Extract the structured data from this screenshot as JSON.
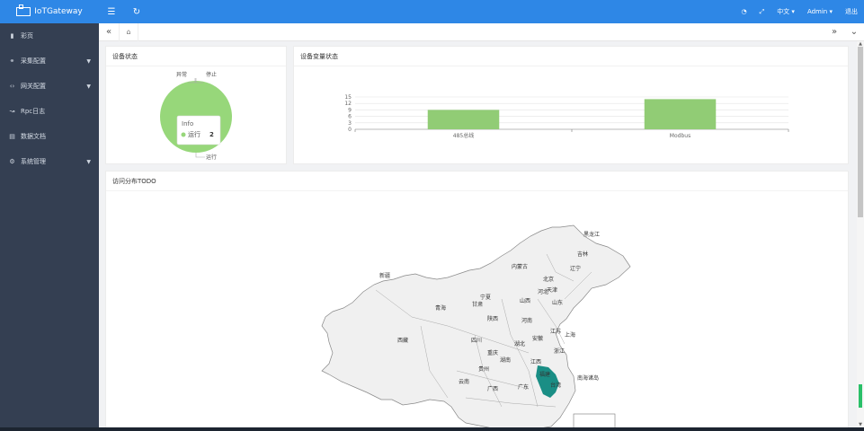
{
  "brand": {
    "name": "IoTGateway"
  },
  "sidebar": {
    "items": [
      {
        "label": "彩页",
        "icon": "dashboard-icon",
        "has_children": false
      },
      {
        "label": "采集配置",
        "icon": "link-icon",
        "has_children": true
      },
      {
        "label": "网关配置",
        "icon": "code-icon",
        "has_children": true
      },
      {
        "label": "Rpc日志",
        "icon": "route-icon",
        "has_children": false
      },
      {
        "label": "数据文档",
        "icon": "document-icon",
        "has_children": false
      },
      {
        "label": "系统管理",
        "icon": "gear-icon",
        "has_children": true
      }
    ]
  },
  "topbar": {
    "menu_icon": "menu-icon",
    "refresh_icon": "refresh-icon",
    "theme_icon": "palette-icon",
    "fullscreen_icon": "fullscreen-icon",
    "language": "中文",
    "user": "Admin",
    "logout": "退出"
  },
  "tabs": {
    "prev": "«",
    "next": "»",
    "more": "⌄"
  },
  "cards": {
    "device_status": {
      "title": "设备状态",
      "labels": {
        "abnormal": "异常",
        "stopped": "停止",
        "running": "运行"
      },
      "tooltip": {
        "title": "Info",
        "label": "运行",
        "value": "2"
      },
      "color": "#97d77a"
    },
    "variable_status": {
      "title": "设备变量状态"
    },
    "map": {
      "title": "访问分布TODO",
      "highlight_color": "#1a8e85",
      "land_color": "#f0f0f0",
      "provinces": [
        "黑龙江",
        "吉林",
        "辽宁",
        "内蒙古",
        "北京",
        "天津",
        "河北",
        "山西",
        "山东",
        "新疆",
        "青海",
        "甘肃",
        "宁夏",
        "陕西",
        "河南",
        "江苏",
        "安徽",
        "上海",
        "西藏",
        "四川",
        "湖北",
        "重庆",
        "湖南",
        "江西",
        "浙江",
        "贵州",
        "福建",
        "云南",
        "广西",
        "广东",
        "台湾",
        "南海诸岛"
      ]
    }
  },
  "chart_data": {
    "type": "bar",
    "categories": [
      "485总线",
      "Modbus"
    ],
    "values": [
      9,
      14
    ],
    "ylim": [
      0,
      15
    ],
    "yticks": [
      0,
      3,
      6,
      9,
      12,
      15
    ],
    "bar_color": "#91cc75",
    "grid": true
  }
}
